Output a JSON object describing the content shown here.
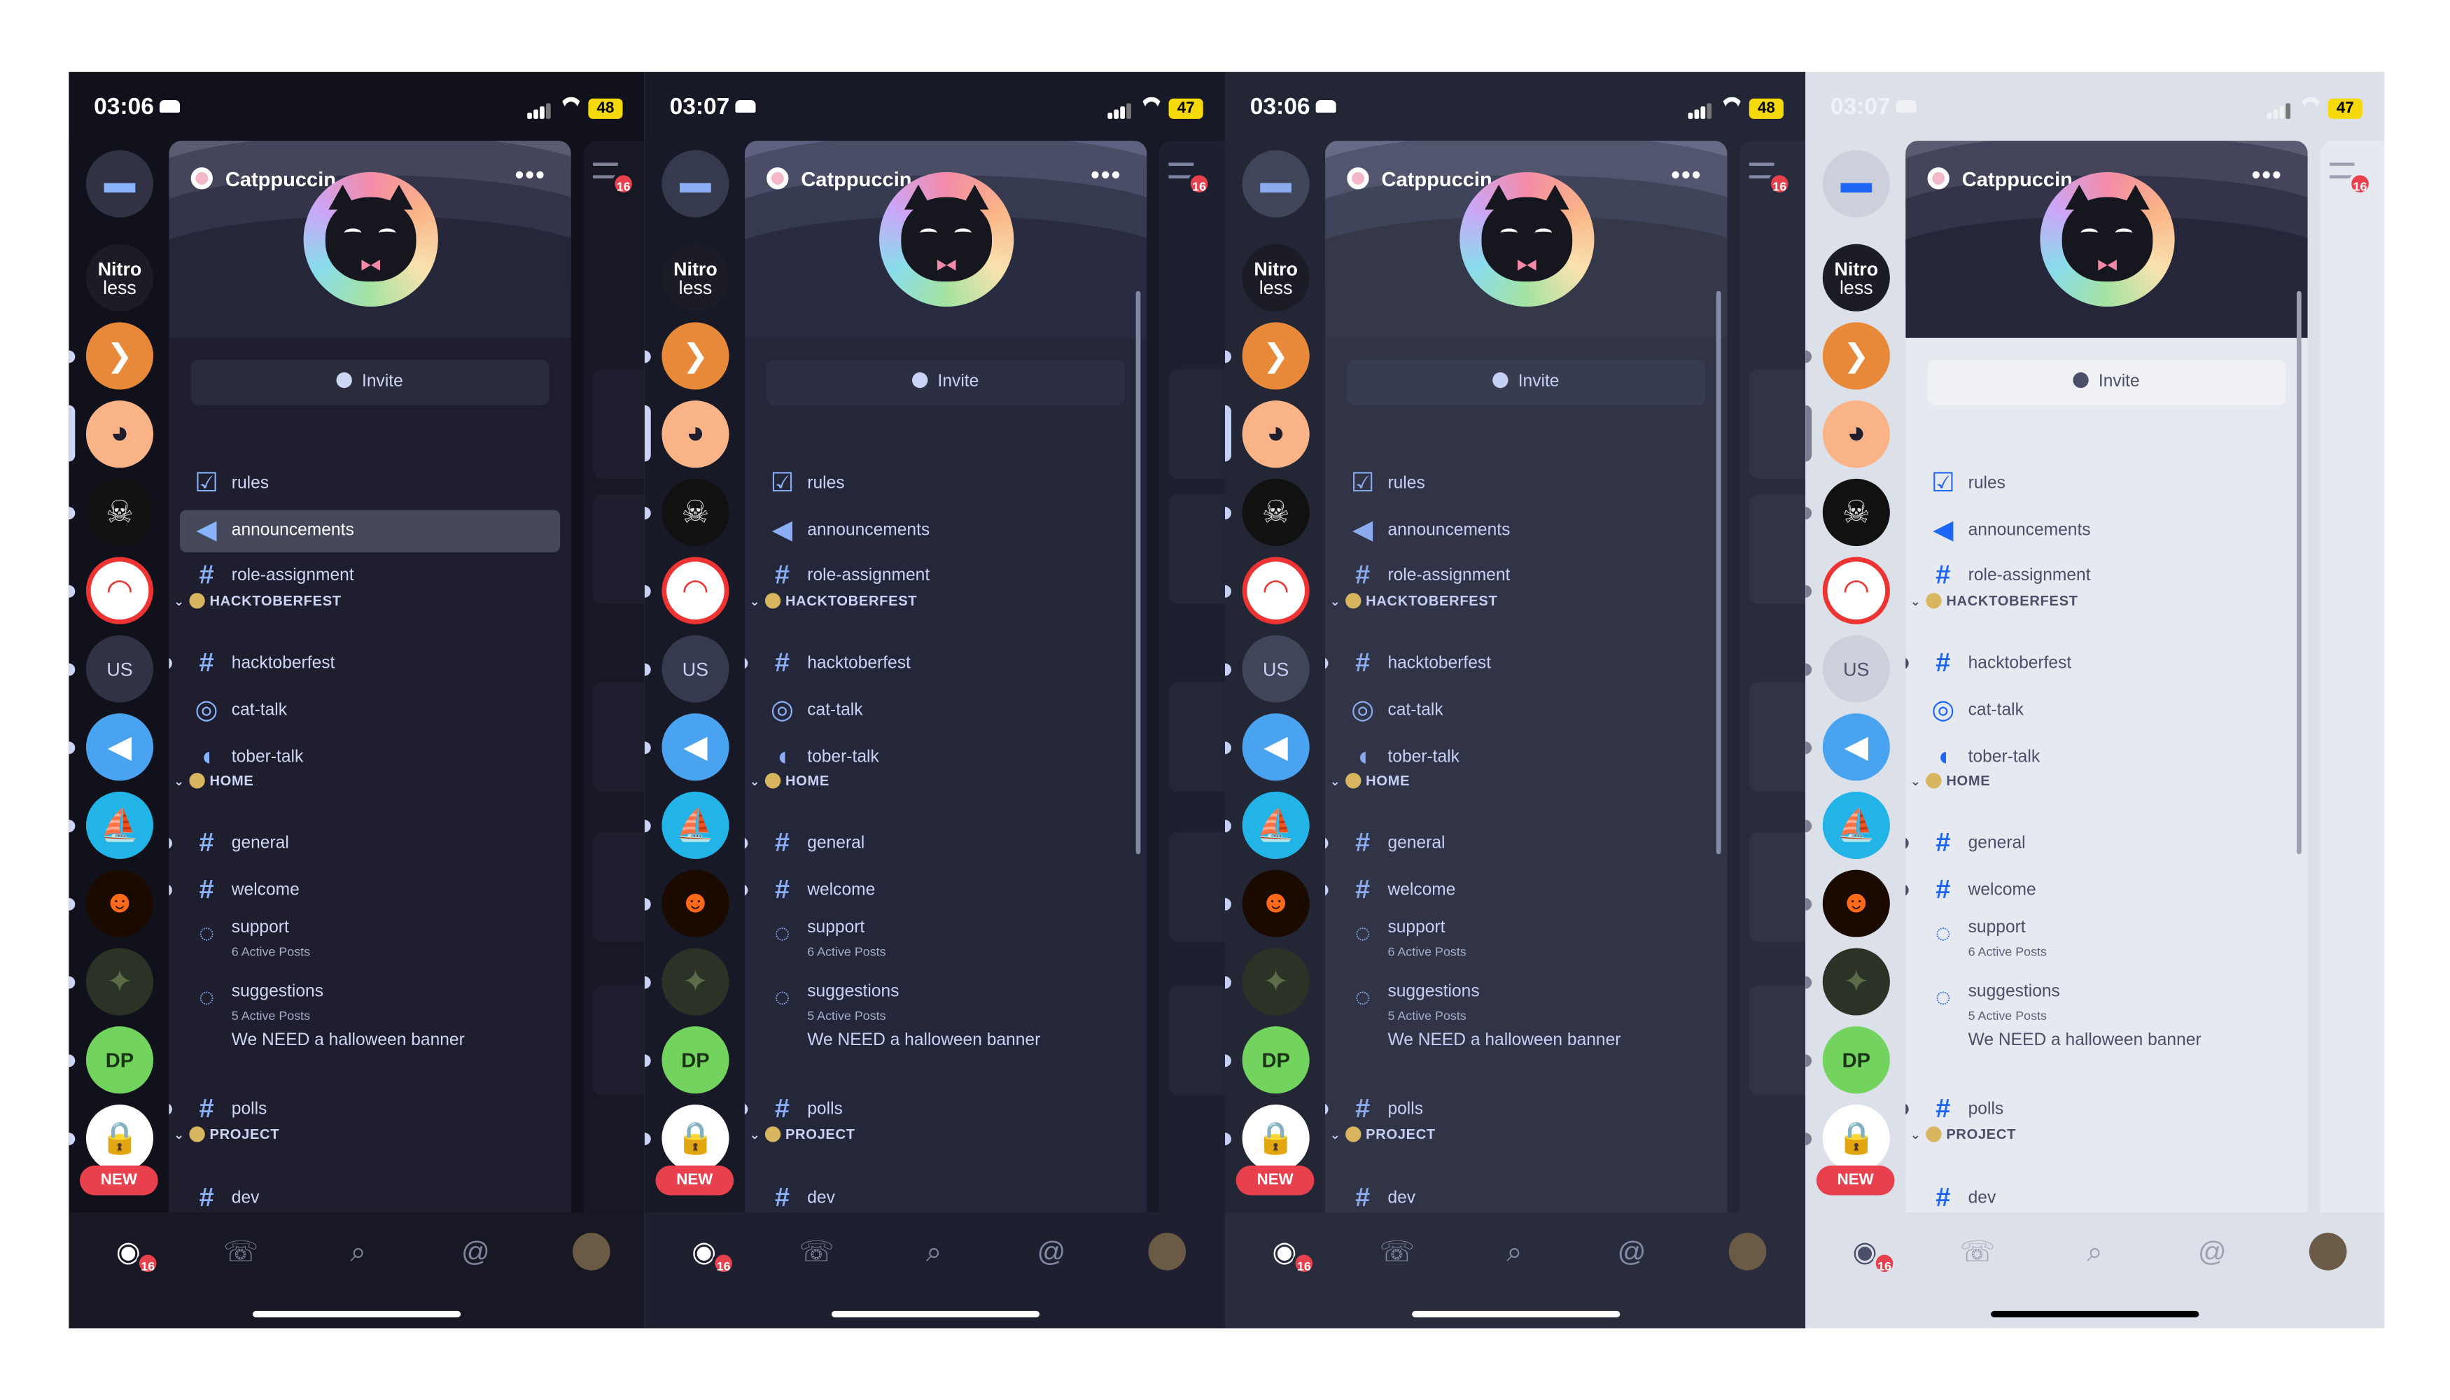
{
  "server": {
    "name": "Catppuccin",
    "invite_label": "Invite",
    "new_tag": "NEW",
    "nitro_line1": "Nitro",
    "nitro_line2": "less",
    "us_label": "US"
  },
  "channels": {
    "rules": "rules",
    "announcements": "announcements",
    "role_assignment": "role-assignment",
    "cat_hacktoberfest": "HACKTOBERFEST",
    "hacktoberfest": "hacktoberfest",
    "cat_talk": "cat-talk",
    "tober_talk": "tober-talk",
    "cat_home": "HOME",
    "general": "general",
    "welcome": "welcome",
    "support": "support",
    "support_sub": "6 Active Posts",
    "suggestions": "suggestions",
    "suggestions_sub": "5 Active Posts",
    "thread": "We NEED a halloween banner",
    "polls": "polls",
    "cat_project": "PROJECT",
    "dev": "dev"
  },
  "mention_badge": "16",
  "peek_badge": "16",
  "phones": [
    {
      "time": "03:06",
      "battery": "48",
      "theme": "mocha",
      "active_channel": "announcements"
    },
    {
      "time": "03:07",
      "battery": "47",
      "theme": "macchiato",
      "active_channel": ""
    },
    {
      "time": "03:06",
      "battery": "48",
      "theme": "frappe",
      "active_channel": ""
    },
    {
      "time": "03:07",
      "battery": "47",
      "theme": "latte",
      "active_channel": ""
    }
  ],
  "icons": [
    "dm-icon",
    "discord-home-icon",
    "friends-icon",
    "search-icon",
    "mention-icon",
    "hash-icon",
    "rules-icon",
    "announcement-icon",
    "stage-icon",
    "voice-icon",
    "forum-icon",
    "invite-icon",
    "more-icon"
  ],
  "colors": {
    "mocha_base": "#1e1e2e",
    "mocha_mantle": "#181825",
    "mocha_crust": "#11111b",
    "macchiato_base": "#24273a",
    "macchiato_mantle": "#1e2030",
    "macchiato_crust": "#181926",
    "frappe_base": "#303446",
    "frappe_mantle": "#292c3c",
    "frappe_crust": "#232634",
    "latte_base": "#eff1f5",
    "latte_mantle": "#e6e9ef",
    "latte_crust": "#dce0e8",
    "blue": "#89b4fa",
    "accent_red": "#e8404d"
  }
}
